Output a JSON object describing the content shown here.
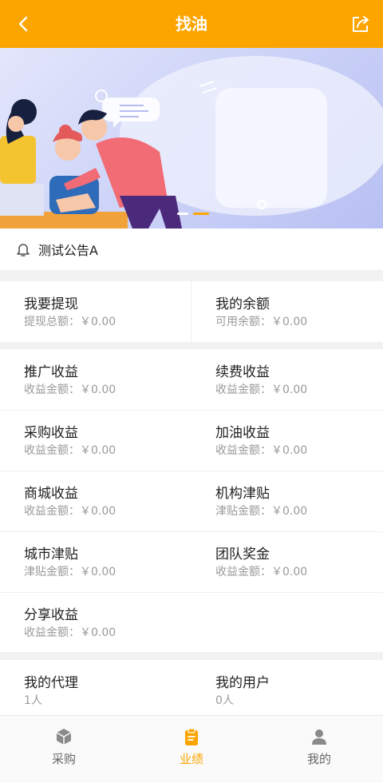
{
  "header": {
    "title": "找油"
  },
  "notice": {
    "text": "测试公告A"
  },
  "wallet": [
    {
      "label": "我要提现",
      "sub": "提现总额：￥0.00"
    },
    {
      "label": "我的余额",
      "sub": "可用余额：￥0.00"
    }
  ],
  "income": [
    {
      "label": "推广收益",
      "sub": "收益金额：￥0.00"
    },
    {
      "label": "续费收益",
      "sub": "收益金额：￥0.00"
    },
    {
      "label": "采购收益",
      "sub": "收益金额：￥0.00"
    },
    {
      "label": "加油收益",
      "sub": "收益金额：￥0.00"
    },
    {
      "label": "商城收益",
      "sub": "收益金额：￥0.00"
    },
    {
      "label": "机构津贴",
      "sub": "津贴金额：￥0.00"
    },
    {
      "label": "城市津贴",
      "sub": "津贴金额：￥0.00"
    },
    {
      "label": "团队奖金",
      "sub": "收益金额：￥0.00"
    },
    {
      "label": "分享收益",
      "sub": "收益金额：￥0.00"
    }
  ],
  "team": [
    {
      "label": "我的代理",
      "sub": "1人"
    },
    {
      "label": "我的用户",
      "sub": "0人"
    }
  ],
  "tabbar": {
    "items": [
      {
        "label": "采购",
        "icon": "cube-icon"
      },
      {
        "label": "业绩",
        "icon": "clipboard-icon"
      },
      {
        "label": "我的",
        "icon": "user-icon"
      }
    ],
    "active": "业绩"
  },
  "colors": {
    "accent": "#fca500",
    "text": "#222222",
    "muted": "#9a9a9a"
  }
}
